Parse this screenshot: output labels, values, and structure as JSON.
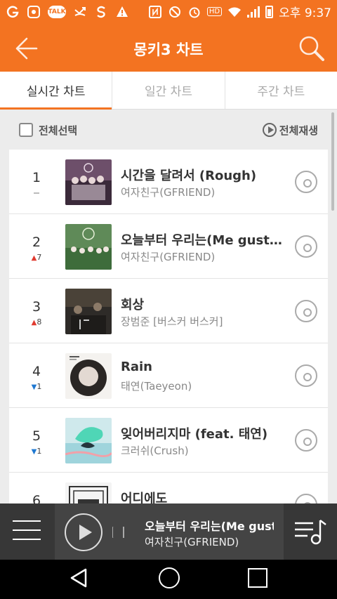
{
  "status_bar": {
    "left_icons": [
      "g-icon",
      "app-icon",
      "kakaotalk-icon",
      "missed-call-icon",
      "s-icon",
      "warning-icon"
    ],
    "talk_label": "TALK",
    "hd_label": "HD",
    "time": "오후 9:37"
  },
  "app_bar": {
    "title": "몽키3 차트",
    "back_icon": "arrow-left-icon",
    "search_icon": "search-icon"
  },
  "tabs": [
    {
      "label": "실시간 차트",
      "active": true
    },
    {
      "label": "일간 차트",
      "active": false
    },
    {
      "label": "주간 차트",
      "active": false
    }
  ],
  "toolbar": {
    "select_all_label": "전체선택",
    "play_all_label": "전체재생"
  },
  "chart": [
    {
      "rank": "1",
      "change": "same",
      "change_value": "",
      "title": "시간을 달려서 (Rough)",
      "artist": "여자친구(GFRIEND)"
    },
    {
      "rank": "2",
      "change": "up",
      "change_value": "7",
      "title": "오늘부터 우리는(Me gustas tu)",
      "artist": "여자친구(GFRIEND)"
    },
    {
      "rank": "3",
      "change": "up",
      "change_value": "8",
      "title": "회상",
      "artist": "장범준 [버스커 버스커]"
    },
    {
      "rank": "4",
      "change": "down",
      "change_value": "1",
      "title": "Rain",
      "artist": "태연(Taeyeon)"
    },
    {
      "rank": "5",
      "change": "down",
      "change_value": "1",
      "title": "잊어버리지마 (feat. 태연)",
      "artist": "크러쉬(Crush)"
    },
    {
      "rank": "6",
      "change": "same",
      "change_value": "",
      "title": "어디에도",
      "artist": ""
    }
  ],
  "now_playing": {
    "title": "오늘부터 우리는(Me gust",
    "artist": "여자친구(GFRIEND)"
  },
  "colors": {
    "accent": "#f37321",
    "up": "#e03a2f",
    "down": "#1f78d1"
  }
}
